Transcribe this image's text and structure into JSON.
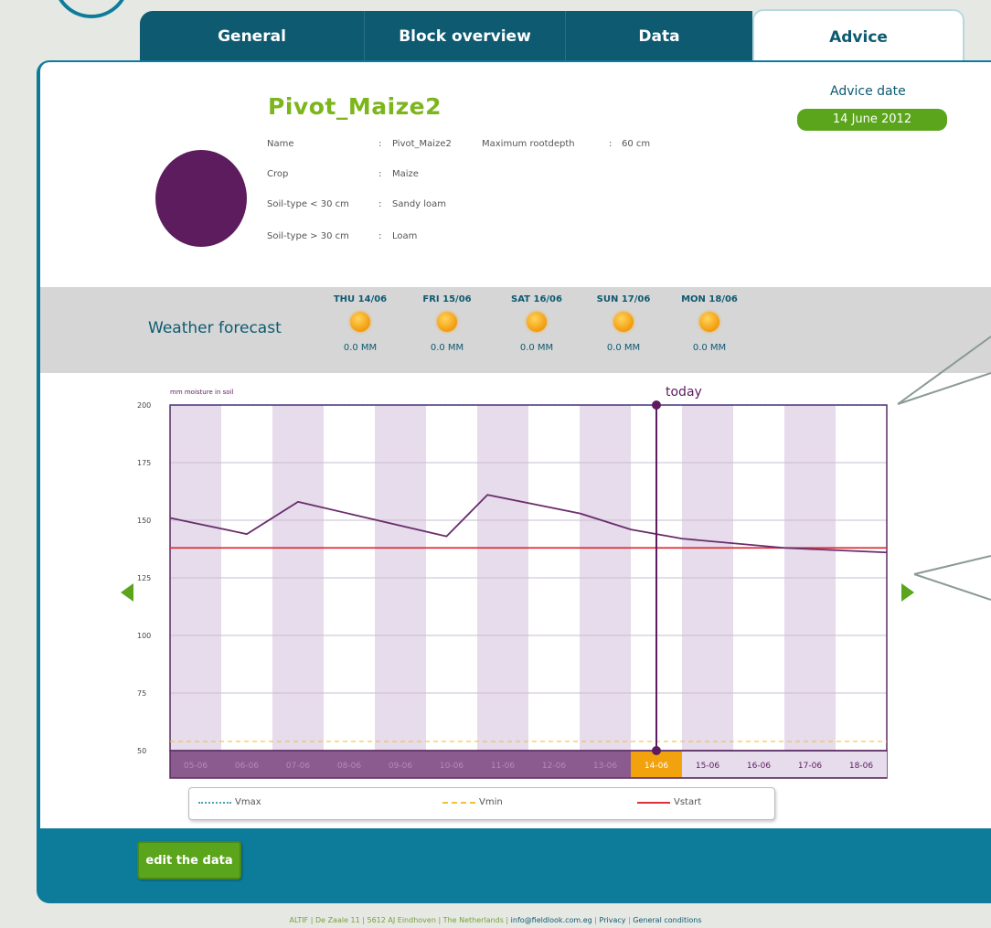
{
  "tabs": [
    {
      "label": "General"
    },
    {
      "label": "Block overview"
    },
    {
      "label": "Data"
    },
    {
      "label": "Advice"
    }
  ],
  "field": {
    "title": "Pivot_Maize2",
    "details": [
      {
        "label": "Name",
        "value": "Pivot_Maize2"
      },
      {
        "label": "Crop",
        "value": "Maize"
      },
      {
        "label": "Soil-type < 30 cm",
        "value": "Sandy loam"
      },
      {
        "label": "Soil-type > 30 cm",
        "value": "Loam"
      }
    ],
    "max_rootdepth_label": "Maximum rootdepth",
    "max_rootdepth_value": "60 cm",
    "crop_color": "#5c1c5e"
  },
  "advice": {
    "label": "Advice date",
    "date": "14 June 2012"
  },
  "weather": {
    "label": "Weather forecast",
    "days": [
      {
        "day": "THU 14/06",
        "icon": "sun-icon",
        "rain": "0.0 MM"
      },
      {
        "day": "FRI 15/06",
        "icon": "sun-icon",
        "rain": "0.0 MM"
      },
      {
        "day": "SAT 16/06",
        "icon": "sun-icon",
        "rain": "0.0 MM"
      },
      {
        "day": "SUN 17/06",
        "icon": "sun-icon",
        "rain": "0.0 MM"
      },
      {
        "day": "MON 18/06",
        "icon": "sun-icon",
        "rain": "0.0 MM"
      }
    ]
  },
  "chart_data": {
    "type": "line",
    "ylabel": "mm moisture in soil",
    "ylim": [
      50,
      200
    ],
    "yticks": [
      200,
      175,
      150,
      125,
      100,
      75,
      50
    ],
    "categories": [
      "05-06",
      "06-06",
      "07-06",
      "08-06",
      "09-06",
      "10-06",
      "11-06",
      "12-06",
      "13-06",
      "14-06",
      "15-06",
      "16-06",
      "17-06",
      "18-06"
    ],
    "highlight_category": "14-06",
    "today_label": "today",
    "today_x": "14-06",
    "series": [
      {
        "name": "Vmax",
        "style": "dotted",
        "color": "#4a63b0",
        "values": [
          200,
          200,
          200,
          200,
          200,
          200,
          200,
          200,
          200,
          200,
          200,
          200,
          200,
          200
        ]
      },
      {
        "name": "Vmin",
        "style": "dashed",
        "color": "#f2c23a",
        "values": [
          54,
          54,
          54,
          54,
          54,
          54,
          54,
          54,
          54,
          54,
          54,
          54,
          54,
          54
        ]
      },
      {
        "name": "Vstart",
        "style": "solid",
        "color": "#e0303a",
        "values": [
          138,
          138,
          138,
          138,
          138,
          138,
          138,
          138,
          138,
          138,
          138,
          138,
          138,
          138
        ]
      },
      {
        "name": "",
        "style": "solid",
        "color": "#6a2d6c",
        "points": [
          [
            0,
            151
          ],
          [
            1.5,
            144
          ],
          [
            2.5,
            158
          ],
          [
            5.4,
            143
          ],
          [
            6.2,
            161
          ],
          [
            8,
            153
          ],
          [
            9,
            146
          ],
          [
            10,
            142
          ],
          [
            12,
            138
          ],
          [
            14,
            136
          ]
        ]
      }
    ],
    "grid": true
  },
  "legend": [
    {
      "name": "Vmax",
      "color": "#4a9fb5",
      "style": "dotted"
    },
    {
      "name": "Vmin",
      "color": "#f2c23a",
      "style": "dashed"
    },
    {
      "name": "Vstart",
      "color": "#e0303a",
      "style": "solid"
    }
  ],
  "edit_button": "edit the data",
  "footer": {
    "address": "ALTIF | De Zaale 11 | 5612 AJ Eindhoven | The Netherlands",
    "email": "info@fieldlook.com.eg",
    "privacy": "Privacy",
    "conditions": "General conditions"
  }
}
